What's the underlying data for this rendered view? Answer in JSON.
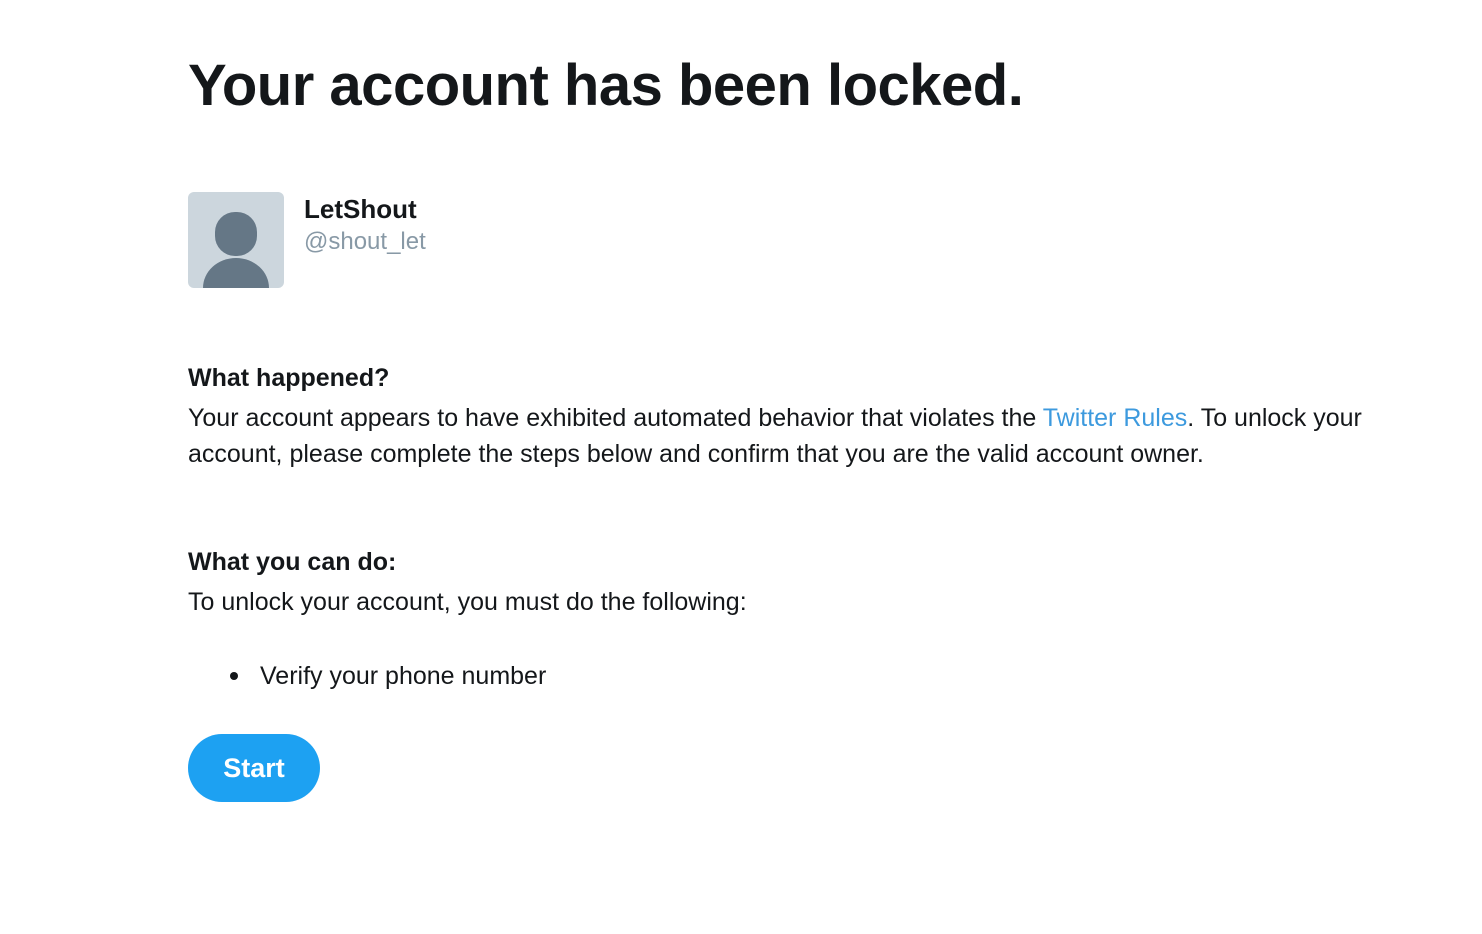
{
  "page": {
    "title": "Your account has been locked."
  },
  "account": {
    "display_name": "LetShout",
    "handle": "@shout_let",
    "avatar_icon": "default-profile-avatar-icon"
  },
  "what_happened": {
    "heading": "What happened?",
    "text_before_link": "Your account appears to have exhibited automated behavior that violates the ",
    "link_text": "Twitter Rules",
    "text_after_link": ". To unlock your account, please complete the steps below and confirm that you are the valid account owner."
  },
  "what_you_can_do": {
    "heading": "What you can do:",
    "intro": "To unlock your account, you must do the following:",
    "steps": [
      "Verify your phone number"
    ]
  },
  "actions": {
    "start_label": "Start"
  },
  "colors": {
    "text": "#14171a",
    "secondary_text": "#8899a6",
    "link": "#3d9ade",
    "button": "#1da1f2",
    "avatar_bg": "#ccd6dd",
    "avatar_figure": "#657786"
  }
}
